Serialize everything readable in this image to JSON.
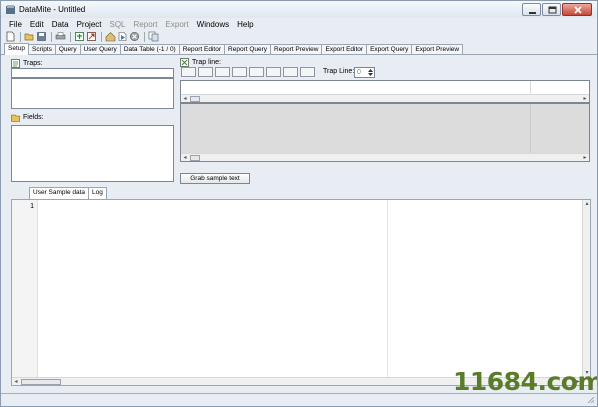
{
  "window": {
    "title": "DataMite - Untitled"
  },
  "menu": [
    "File",
    "Edit",
    "Data",
    "Project",
    "SQL",
    "Report",
    "Export",
    "Windows",
    "Help"
  ],
  "menu_disabled": [
    "SQL",
    "Report",
    "Export"
  ],
  "toolbar_icons": [
    "new-icon",
    "open-icon",
    "save-icon",
    "print-icon",
    "import-icon",
    "export-icon",
    "home-icon",
    "run-icon",
    "stop-icon",
    "copy-icon"
  ],
  "tabs": [
    "Setup",
    "Scripts",
    "Query",
    "User Query",
    "Data Table (-1 / 0)",
    "Report Editor",
    "Report Query",
    "Report Preview",
    "Export Editor",
    "Export Query",
    "Export Preview"
  ],
  "active_tab": "Setup",
  "setup": {
    "traps_label": "Traps:",
    "fields_label": "Fields:",
    "trap_line_section_label": "Trap line:",
    "trap_line_field_label": "Trap Line:",
    "trap_line_value": "0",
    "grab_button_label": "Grab sample text"
  },
  "bottom_tabs": [
    "User Sample data",
    "Log"
  ],
  "editor": {
    "line_number": "1"
  },
  "watermark": "11684.com"
}
